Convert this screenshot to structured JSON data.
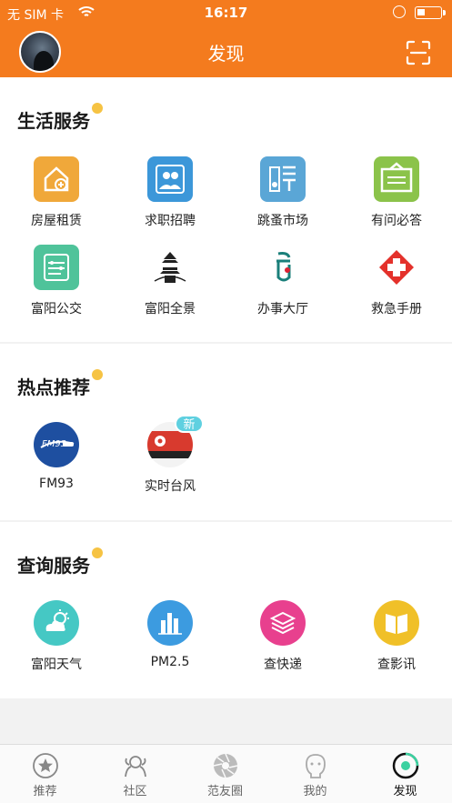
{
  "status_bar": {
    "carrier": "无 SIM 卡",
    "time": "16:17"
  },
  "header": {
    "title": "发现",
    "avatar_icon": "user-avatar",
    "scan_icon": "scan-icon"
  },
  "sections": {
    "life": {
      "title": "生活服务",
      "items": [
        {
          "label": "房屋租赁",
          "icon": "house-plus-icon",
          "color": "#f0a83a"
        },
        {
          "label": "求职招聘",
          "icon": "people-icon",
          "color": "#3c97d9"
        },
        {
          "label": "跳蚤市场",
          "icon": "market-icon",
          "color": "#5aa6d6"
        },
        {
          "label": "有问必答",
          "icon": "qa-icon",
          "color": "#8bc34a"
        },
        {
          "label": "富阳公交",
          "icon": "bus-icon",
          "color": "#4fc39a"
        },
        {
          "label": "富阳全景",
          "icon": "pagoda-icon",
          "color": "#ffffff"
        },
        {
          "label": "办事大厅",
          "icon": "hall-logo-icon",
          "color": "#ffffff"
        },
        {
          "label": "救急手册",
          "icon": "red-cross-icon",
          "color": "#ffffff"
        }
      ]
    },
    "hot": {
      "title": "热点推荐",
      "items": [
        {
          "label": "FM93",
          "icon": "radio-fm93-icon",
          "color": "#1e4fa0"
        },
        {
          "label": "实时台风",
          "icon": "typhoon-icon",
          "color": "#d83a2e",
          "badge": "新"
        }
      ]
    },
    "query": {
      "title": "查询服务",
      "items": [
        {
          "label": "富阳天气",
          "icon": "weather-icon",
          "color": "#45c8c4"
        },
        {
          "label": "PM2.5",
          "icon": "bar-chart-icon",
          "color": "#3c9be0"
        },
        {
          "label": "查快递",
          "icon": "layers-icon",
          "color": "#e8408e"
        },
        {
          "label": "查影讯",
          "icon": "book-icon",
          "color": "#f0c028"
        }
      ]
    }
  },
  "tabbar": [
    {
      "label": "推荐",
      "icon": "star-icon"
    },
    {
      "label": "社区",
      "icon": "community-icon"
    },
    {
      "label": "范友圈",
      "icon": "aperture-icon"
    },
    {
      "label": "我的",
      "icon": "person-icon"
    },
    {
      "label": "发现",
      "icon": "discover-icon",
      "active": true
    }
  ]
}
